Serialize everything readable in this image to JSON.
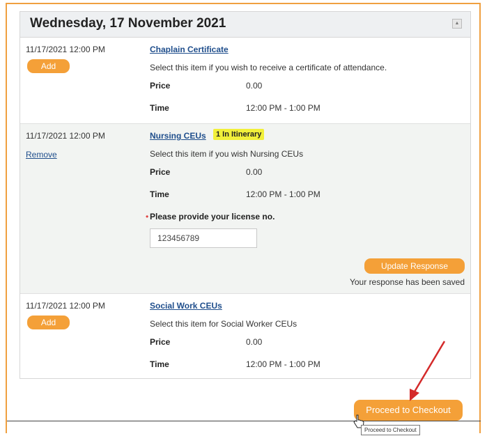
{
  "header": {
    "title": "Wednesday, 17 November 2021",
    "collapse_icon": "up-triangle"
  },
  "items": [
    {
      "datetime": "11/17/2021 12:00 PM",
      "action": "Add",
      "title": "Chaplain Certificate",
      "description": "Select this item if you wish to receive a certificate of attendance.",
      "price_label": "Price",
      "price": "0.00",
      "time_label": "Time",
      "time": "12:00 PM - 1:00 PM"
    },
    {
      "datetime": "11/17/2021 12:00 PM",
      "action": "Remove",
      "title": "Nursing CEUs",
      "badge": "1 In Itinerary",
      "description": "Select this item if you wish Nursing CEUs",
      "price_label": "Price",
      "price": "0.00",
      "time_label": "Time",
      "time": "12:00 PM - 1:00 PM",
      "question": "Please provide your license no.",
      "license_value": "123456789",
      "update_button": "Update Response",
      "saved_message": "Your response has been saved"
    },
    {
      "datetime": "11/17/2021 12:00 PM",
      "action": "Add",
      "title": "Social Work CEUs",
      "description": "Select this item for Social Worker CEUs",
      "price_label": "Price",
      "price": "0.00",
      "time_label": "Time",
      "time": "12:00 PM - 1:00 PM"
    }
  ],
  "footer": {
    "checkout_button": "Proceed to Checkout",
    "tooltip": "Proceed to Checkout"
  },
  "colors": {
    "accent": "#f4a038",
    "link": "#1f4e8c",
    "badge": "#f2f03a",
    "annotation_arrow": "#d42a2a"
  }
}
